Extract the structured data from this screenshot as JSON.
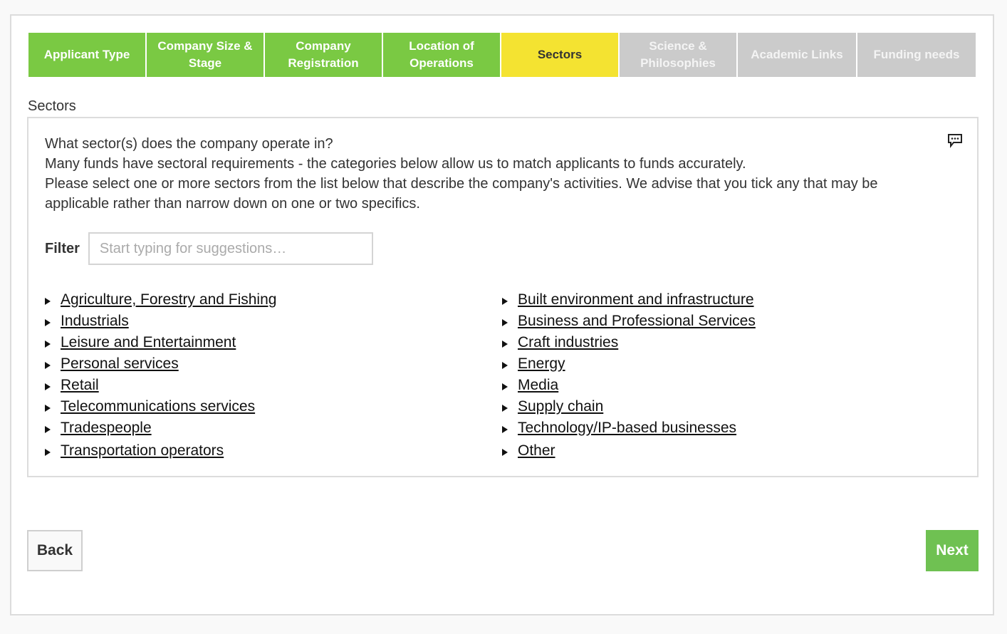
{
  "steps": [
    {
      "label": "Applicant Type",
      "state": "done"
    },
    {
      "label": "Company Size & Stage",
      "state": "done"
    },
    {
      "label": "Company Registration",
      "state": "done"
    },
    {
      "label": "Location of Operations",
      "state": "done"
    },
    {
      "label": "Sectors",
      "state": "current"
    },
    {
      "label": "Science & Philosophies",
      "state": "todo"
    },
    {
      "label": "Academic Links",
      "state": "todo"
    },
    {
      "label": "Funding needs",
      "state": "todo"
    }
  ],
  "colors": {
    "done": "#7ac943",
    "current": "#f4e331",
    "todo": "#cbcbcb",
    "next_button": "#6fc152"
  },
  "section_label": "Sectors",
  "intro": {
    "line1": "What sector(s) does the company operate in?",
    "line2": "Many funds have sectoral requirements - the categories below allow us to match applicants to funds accurately.",
    "line3": "Please select one or more sectors from the list below that describe the company's activities. We advise that you tick any that may be applicable rather than narrow down on one or two specifics."
  },
  "comment_icon": "speech-bubble-icon",
  "filter": {
    "label": "Filter",
    "value": "",
    "placeholder": "Start typing for suggestions…"
  },
  "sectors_left": [
    "Agriculture, Forestry and Fishing",
    "Industrials",
    "Leisure and Entertainment",
    "Personal services",
    "Retail",
    "Telecommunications services",
    "Tradespeople",
    "Transportation operators"
  ],
  "sectors_right": [
    "Built environment and infrastructure",
    "Business and Professional Services",
    "Craft industries",
    "Energy",
    "Media",
    "Supply chain",
    "Technology/IP-based businesses",
    "Other"
  ],
  "buttons": {
    "back": "Back",
    "next": "Next"
  }
}
